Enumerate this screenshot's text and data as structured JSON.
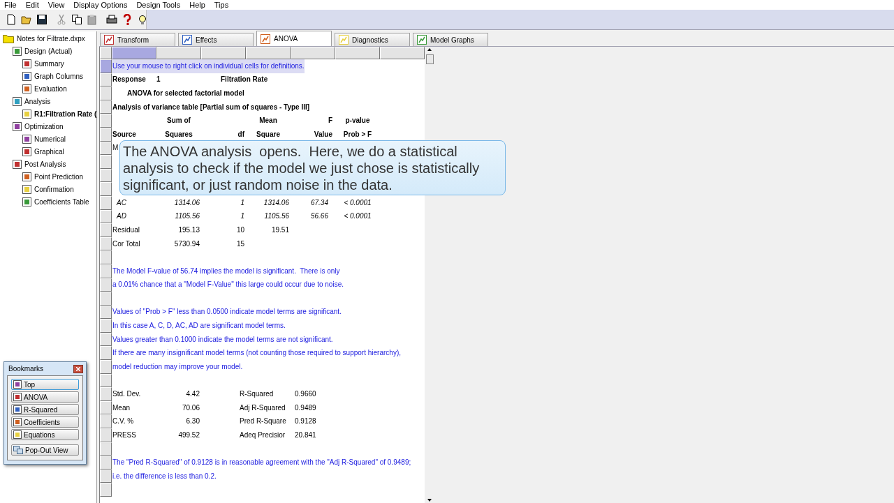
{
  "menu": [
    "File",
    "Edit",
    "View",
    "Display Options",
    "Design Tools",
    "Help",
    "Tips"
  ],
  "tree": {
    "label": "Notes for Filtrate.dxpx",
    "children": [
      {
        "label": "Design (Actual)",
        "selected": false,
        "children": [
          {
            "label": "Summary",
            "selected": false
          },
          {
            "label": "Graph Columns",
            "selected": false
          },
          {
            "label": "Evaluation",
            "selected": false
          }
        ]
      },
      {
        "label": "Analysis",
        "selected": false,
        "children": [
          {
            "label": "R1:Filtration Rate (",
            "selected": true
          }
        ]
      },
      {
        "label": "Optimization",
        "selected": false,
        "children": [
          {
            "label": "Numerical",
            "selected": false
          },
          {
            "label": "Graphical",
            "selected": false
          }
        ]
      },
      {
        "label": "Post Analysis",
        "selected": false,
        "children": [
          {
            "label": "Point Prediction",
            "selected": false
          },
          {
            "label": "Confirmation",
            "selected": false
          },
          {
            "label": "Coefficients Table",
            "selected": false
          }
        ]
      }
    ]
  },
  "tabs": [
    {
      "label": "Transform",
      "selected": false
    },
    {
      "label": "Effects",
      "selected": false
    },
    {
      "label": "ANOVA",
      "selected": true
    },
    {
      "label": "Diagnostics",
      "selected": false
    },
    {
      "label": "Model Graphs",
      "selected": false
    }
  ],
  "rows": [
    {
      "kind": "note",
      "selected": true,
      "text": "Use your mouse to right click on individual cells for definitions."
    },
    {
      "kind": "response",
      "selected": false,
      "label": "Response",
      "number": "1",
      "name": "Filtration Rate"
    },
    {
      "kind": "subheading",
      "selected": false,
      "text": "ANOVA for selected factorial model"
    },
    {
      "kind": "heading",
      "selected": false,
      "text": "Analysis of variance table [Partial sum of squares - Type III]"
    },
    {
      "kind": "header",
      "selected": false,
      "sum_of_squares": "Sum of",
      "mean_square": "Mean",
      "f_value": "F",
      "p_value": "p-value"
    },
    {
      "kind": "header",
      "selected": false,
      "source": "Source",
      "sum_of_squares": "Squares",
      "df": "df",
      "mean_square": "Square",
      "f_value": "Value",
      "p_value": "Prob > F"
    },
    {
      "kind": "term",
      "selected": false,
      "italic": false,
      "source": "M"
    },
    {
      "kind": "blank",
      "selected": false
    },
    {
      "kind": "blank",
      "selected": false
    },
    {
      "kind": "blank",
      "selected": false
    },
    {
      "kind": "term",
      "selected": false,
      "italic": true,
      "source": "AC",
      "sum_of_squares": "1314.06",
      "df": "1",
      "mean_square": "1314.06",
      "f_value": "67.34",
      "p_value": "< 0.0001"
    },
    {
      "kind": "term",
      "selected": false,
      "italic": true,
      "source": "AD",
      "sum_of_squares": "1105.56",
      "df": "1",
      "mean_square": "1105.56",
      "f_value": "56.66",
      "p_value": "< 0.0001"
    },
    {
      "kind": "term",
      "selected": false,
      "italic": false,
      "source": "Residual",
      "sum_of_squares": "195.13",
      "df": "10",
      "mean_square": "19.51"
    },
    {
      "kind": "term",
      "selected": false,
      "italic": false,
      "source": "Cor Total",
      "sum_of_squares": "5730.94",
      "df": "15"
    },
    {
      "kind": "blank",
      "selected": false
    },
    {
      "kind": "note",
      "selected": false,
      "text": "The Model F-value of 56.74 implies the model is significant.  There is only"
    },
    {
      "kind": "note",
      "selected": false,
      "text": "a 0.01% chance that a \"Model F-Value\" this large could occur due to noise."
    },
    {
      "kind": "blank",
      "selected": false
    },
    {
      "kind": "note",
      "selected": false,
      "text": "Values of \"Prob > F\" less than 0.0500 indicate model terms are significant."
    },
    {
      "kind": "note",
      "selected": false,
      "text": "In this case A, C, D, AC, AD are significant model terms."
    },
    {
      "kind": "note",
      "selected": false,
      "text": "Values greater than 0.1000 indicate the model terms are not significant."
    },
    {
      "kind": "note",
      "selected": false,
      "text": "If there are many insignificant model terms (not counting those required to support hierarchy),"
    },
    {
      "kind": "note",
      "selected": false,
      "text": "model reduction may improve your model."
    },
    {
      "kind": "blank",
      "selected": false
    },
    {
      "kind": "stat",
      "selected": false,
      "label": "Std. Dev.",
      "value": "4.42",
      "label2": "R-Squared",
      "value2": "0.9660"
    },
    {
      "kind": "stat",
      "selected": false,
      "label": "Mean",
      "value": "70.06",
      "label2": "Adj R-Squared",
      "value2": "0.9489"
    },
    {
      "kind": "stat",
      "selected": false,
      "label": "C.V. %",
      "value": "6.30",
      "label2": "Pred R-Square",
      "value2": "0.9128"
    },
    {
      "kind": "stat",
      "selected": false,
      "label": "PRESS",
      "value": "499.52",
      "label2": "Adeq Precisior",
      "value2": "20.841"
    },
    {
      "kind": "blank",
      "selected": false
    },
    {
      "kind": "note",
      "selected": false,
      "text": "The \"Pred R-Squared\" of 0.9128 is in reasonable agreement with the \"Adj R-Squared\" of 0.9489;"
    },
    {
      "kind": "note",
      "selected": false,
      "text": "i.e. the difference is less than 0.2."
    },
    {
      "kind": "blank",
      "selected": false
    }
  ],
  "callout": {
    "text": "The ANOVA analysis  opens.  Here, we do a statistical analysis to check if the model we just chose is statistically significant, or just random noise in the data."
  },
  "bookmarks": {
    "title": "Bookmarks",
    "items": [
      {
        "label": "Top",
        "selected": true
      },
      {
        "label": "ANOVA",
        "selected": false
      },
      {
        "label": "R-Squared",
        "selected": false
      },
      {
        "label": "Coefficients",
        "selected": false
      },
      {
        "label": "Equations",
        "selected": false
      }
    ],
    "popout": "Pop-Out View"
  }
}
